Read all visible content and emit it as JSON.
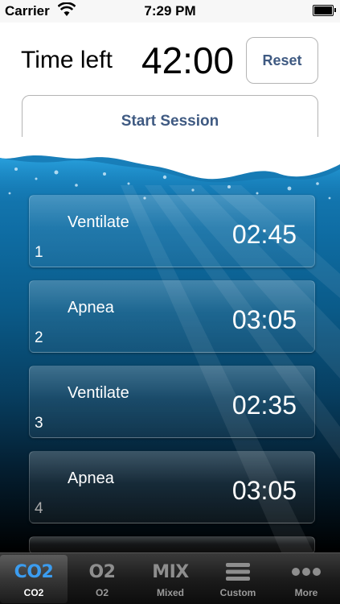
{
  "status_bar": {
    "carrier": "Carrier",
    "time": "7:29 PM"
  },
  "header": {
    "time_left_label": "Time left",
    "time_left_value": "42:00",
    "reset_label": "Reset",
    "start_label": "Start Session"
  },
  "session": {
    "rows": [
      {
        "phase": "Ventilate",
        "duration": "02:45",
        "index": "1"
      },
      {
        "phase": "Apnea",
        "duration": "03:05",
        "index": "2"
      },
      {
        "phase": "Ventilate",
        "duration": "02:35",
        "index": "3"
      },
      {
        "phase": "Apnea",
        "duration": "03:05",
        "index": "4"
      }
    ]
  },
  "tabs": [
    {
      "glyph": "CO2",
      "label": "CO2",
      "active": true
    },
    {
      "glyph": "O2",
      "label": "O2",
      "active": false
    },
    {
      "glyph": "MIX",
      "label": "Mixed",
      "active": false
    },
    {
      "glyph": "list-icon",
      "label": "Custom",
      "active": false
    },
    {
      "glyph": "more-icon",
      "label": "More",
      "active": false
    }
  ],
  "colors": {
    "accent": "#3f5a82",
    "tab_active": "#3b9cef"
  }
}
